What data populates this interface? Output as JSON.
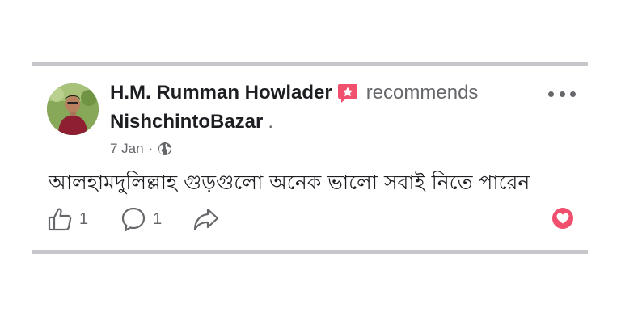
{
  "post": {
    "author": "H.M. Rumman Howlader",
    "verb": "recommends",
    "page": "NishchintoBazar",
    "page_suffix": ".",
    "date": "7 Jan",
    "separator": "·",
    "text": "আলহামদুলিল্লাহ গুড়গুলো অনেক ভালো সবাই নিতে পারেন",
    "audience_icon": "globe-icon",
    "recommend_icon": "recommend-badge-icon"
  },
  "reactions": {
    "like_count": "1",
    "comment_count": "1",
    "reaction_icon": "love-icon"
  },
  "colors": {
    "primary_text": "#1c1e21",
    "secondary_text": "#65676b",
    "recommend_red": "#f0506e",
    "divider": "#c6c7cb"
  }
}
